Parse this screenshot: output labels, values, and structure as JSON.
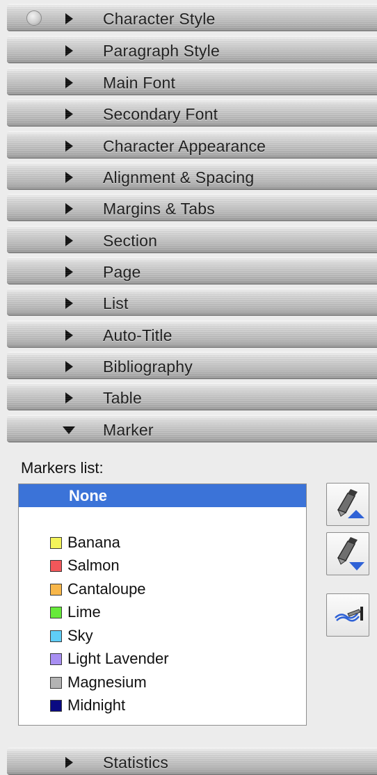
{
  "sections": [
    {
      "label": "Character Style",
      "expanded": false
    },
    {
      "label": "Paragraph Style",
      "expanded": false
    },
    {
      "label": "Main Font",
      "expanded": false
    },
    {
      "label": "Secondary Font",
      "expanded": false
    },
    {
      "label": "Character Appearance",
      "expanded": false
    },
    {
      "label": "Alignment & Spacing",
      "expanded": false
    },
    {
      "label": "Margins & Tabs",
      "expanded": false
    },
    {
      "label": "Section",
      "expanded": false
    },
    {
      "label": "Page",
      "expanded": false
    },
    {
      "label": "List",
      "expanded": false
    },
    {
      "label": "Auto-Title",
      "expanded": false
    },
    {
      "label": "Bibliography",
      "expanded": false
    },
    {
      "label": "Table",
      "expanded": false
    },
    {
      "label": "Marker",
      "expanded": true
    }
  ],
  "marker_panel": {
    "list_label": "Markers list:",
    "selected": "None",
    "items": [
      {
        "label": "None",
        "color": null
      },
      {
        "label": "Banana",
        "color": "#f4f45a"
      },
      {
        "label": "Salmon",
        "color": "#f2575a"
      },
      {
        "label": "Cantaloupe",
        "color": "#f8b74a"
      },
      {
        "label": "Lime",
        "color": "#66ea3a"
      },
      {
        "label": "Sky",
        "color": "#5fcdf7"
      },
      {
        "label": "Light Lavender",
        "color": "#a88ff2"
      },
      {
        "label": "Magnesium",
        "color": "#b3b3b3"
      },
      {
        "label": "Midnight",
        "color": "#0a0a82"
      }
    ],
    "tools": [
      {
        "icon": "marker-up-icon"
      },
      {
        "icon": "marker-down-icon"
      },
      {
        "icon": "marker-apply-icon"
      }
    ]
  },
  "footer_section": {
    "label": "Statistics",
    "expanded": false
  },
  "colors": {
    "selection": "#3b73d8",
    "arrow_blue": "#2f62d6"
  }
}
